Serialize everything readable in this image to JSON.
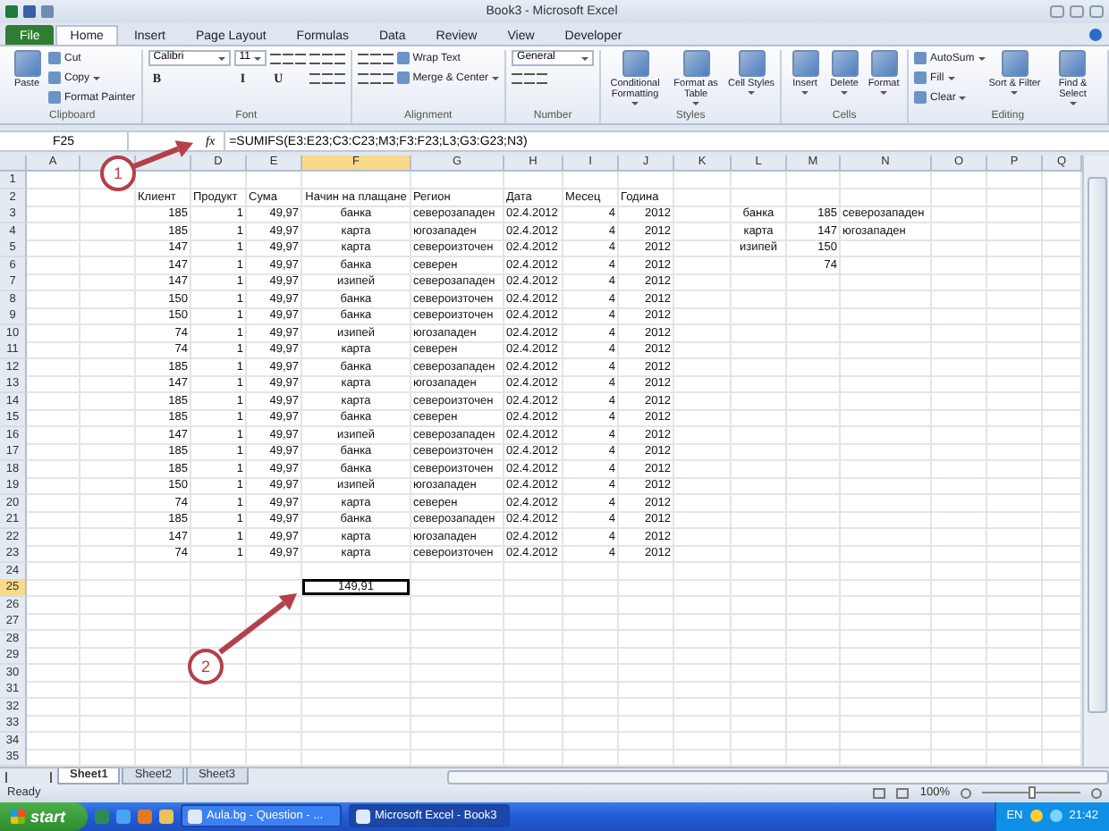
{
  "window": {
    "title": "Book3 - Microsoft Excel"
  },
  "ribbon_tabs": [
    {
      "label": "File",
      "kind": "file",
      "selected": false
    },
    {
      "label": "Home",
      "kind": "tab",
      "selected": true
    },
    {
      "label": "Insert",
      "kind": "tab",
      "selected": false
    },
    {
      "label": "Page Layout",
      "kind": "tab",
      "selected": false
    },
    {
      "label": "Formulas",
      "kind": "tab",
      "selected": false
    },
    {
      "label": "Data",
      "kind": "tab",
      "selected": false
    },
    {
      "label": "Review",
      "kind": "tab",
      "selected": false
    },
    {
      "label": "View",
      "kind": "tab",
      "selected": false
    },
    {
      "label": "Developer",
      "kind": "tab",
      "selected": false
    }
  ],
  "ribbon_groups": [
    {
      "label": "Clipboard",
      "columns": [
        [
          {
            "kind": "large",
            "label": "Paste"
          }
        ],
        [
          {
            "kind": "small",
            "label": "Cut"
          },
          {
            "kind": "small",
            "label": "Copy",
            "menu": true
          },
          {
            "kind": "small",
            "label": "Format Painter"
          }
        ]
      ]
    },
    {
      "label": "Font",
      "columns": [
        [
          {
            "kind": "field",
            "value": "Calibri",
            "wide": true
          },
          {
            "kind": "glyph",
            "label": "B"
          }
        ],
        [
          {
            "kind": "field",
            "value": "11",
            "wide": false
          },
          {
            "kind": "glyph",
            "label": "I"
          }
        ],
        [
          {
            "kind": "tools"
          },
          {
            "kind": "glyph",
            "label": "U"
          }
        ],
        [
          {
            "kind": "tools"
          },
          {
            "kind": "tools"
          }
        ]
      ]
    },
    {
      "label": "Alignment",
      "columns": [
        [
          {
            "kind": "tools"
          },
          {
            "kind": "tools"
          }
        ],
        [
          {
            "kind": "small",
            "label": "Wrap Text"
          },
          {
            "kind": "small",
            "label": "Merge & Center",
            "menu": true
          }
        ]
      ]
    },
    {
      "label": "Number",
      "columns": [
        [
          {
            "kind": "field",
            "value": "General",
            "wide": true
          },
          {
            "kind": "tools"
          }
        ]
      ]
    },
    {
      "label": "Styles",
      "columns": [
        [
          {
            "kind": "large",
            "label": "Conditional Formatting",
            "menu": true
          }
        ],
        [
          {
            "kind": "large",
            "label": "Format as Table",
            "menu": true
          }
        ],
        [
          {
            "kind": "large",
            "label": "Cell Styles",
            "menu": true
          }
        ]
      ]
    },
    {
      "label": "Cells",
      "columns": [
        [
          {
            "kind": "large",
            "label": "Insert",
            "menu": true
          }
        ],
        [
          {
            "kind": "large",
            "label": "Delete",
            "menu": true
          }
        ],
        [
          {
            "kind": "large",
            "label": "Format",
            "menu": true
          }
        ]
      ]
    },
    {
      "label": "Editing",
      "columns": [
        [
          {
            "kind": "small",
            "label": "AutoSum",
            "menu": true
          },
          {
            "kind": "small",
            "label": "Fill",
            "menu": true
          },
          {
            "kind": "small",
            "label": "Clear",
            "menu": true
          }
        ],
        [
          {
            "kind": "large",
            "label": "Sort & Filter",
            "menu": true
          }
        ],
        [
          {
            "kind": "large",
            "label": "Find & Select",
            "menu": true
          }
        ]
      ]
    }
  ],
  "formula_bar": {
    "name_box": "F25",
    "function_label": "fx",
    "formula": "=SUMIFS(E3:E23;C3:C23;M3;F3:F23;L3;G3:G23;N3)"
  },
  "columns": [
    {
      "label": "A",
      "selected": false
    },
    {
      "selected": false
    },
    {
      "selected": false
    },
    {
      "label": "D",
      "selected": false
    },
    {
      "label": "E",
      "selected": false
    },
    {
      "label": "F",
      "selected": true
    },
    {
      "label": "G",
      "selected": false
    },
    {
      "label": "H",
      "selected": false
    },
    {
      "label": "I",
      "selected": false
    },
    {
      "label": "J",
      "selected": false
    },
    {
      "label": "K",
      "selected": false
    },
    {
      "label": "L",
      "selected": false
    },
    {
      "label": "M",
      "selected": false
    },
    {
      "label": "N",
      "selected": false
    },
    {
      "label": "O",
      "selected": false
    },
    {
      "label": "P",
      "selected": false
    },
    {
      "label": "Q",
      "selected": false
    }
  ],
  "rows": [
    {
      "number": "1",
      "selected": false
    },
    {
      "number": "2",
      "selected": false,
      "cells": [
        null,
        null,
        "Клиент",
        "Продукт",
        "Сума",
        "Начин на плащане",
        "Регион",
        "Дата",
        "Месец",
        "Година",
        null,
        null,
        null,
        null,
        null,
        null,
        null
      ]
    },
    {
      "number": "3",
      "selected": false,
      "cells": [
        null,
        null,
        "185",
        "1",
        "49,97",
        "банка",
        "северозападен",
        "02.4.2012",
        "4",
        "2012",
        null,
        "банка",
        "185",
        "северозападен",
        null,
        null,
        null
      ]
    },
    {
      "number": "4",
      "selected": false,
      "cells": [
        null,
        null,
        "185",
        "1",
        "49,97",
        "карта",
        "югозападен",
        "02.4.2012",
        "4",
        "2012",
        null,
        "карта",
        "147",
        "югозападен",
        null,
        null,
        null
      ]
    },
    {
      "number": "5",
      "selected": false,
      "cells": [
        null,
        null,
        "147",
        "1",
        "49,97",
        "карта",
        "североизточен",
        "02.4.2012",
        "4",
        "2012",
        null,
        "изипей",
        "150",
        null,
        null,
        null,
        null
      ]
    },
    {
      "number": "6",
      "selected": false,
      "cells": [
        null,
        null,
        "147",
        "1",
        "49,97",
        "банка",
        "северен",
        "02.4.2012",
        "4",
        "2012",
        null,
        null,
        "74",
        null,
        null,
        null,
        null
      ]
    },
    {
      "number": "7",
      "selected": false,
      "cells": [
        null,
        null,
        "147",
        "1",
        "49,97",
        "изипей",
        "северозападен",
        "02.4.2012",
        "4",
        "2012",
        null,
        null,
        null,
        null,
        null,
        null,
        null
      ]
    },
    {
      "number": "8",
      "selected": false,
      "cells": [
        null,
        null,
        "150",
        "1",
        "49,97",
        "банка",
        "североизточен",
        "02.4.2012",
        "4",
        "2012",
        null,
        null,
        null,
        null,
        null,
        null,
        null
      ]
    },
    {
      "number": "9",
      "selected": false,
      "cells": [
        null,
        null,
        "150",
        "1",
        "49,97",
        "банка",
        "североизточен",
        "02.4.2012",
        "4",
        "2012",
        null,
        null,
        null,
        null,
        null,
        null,
        null
      ]
    },
    {
      "number": "10",
      "selected": false,
      "cells": [
        null,
        null,
        "74",
        "1",
        "49,97",
        "изипей",
        "югозападен",
        "02.4.2012",
        "4",
        "2012",
        null,
        null,
        null,
        null,
        null,
        null,
        null
      ]
    },
    {
      "number": "11",
      "selected": false,
      "cells": [
        null,
        null,
        "74",
        "1",
        "49,97",
        "карта",
        "северен",
        "02.4.2012",
        "4",
        "2012",
        null,
        null,
        null,
        null,
        null,
        null,
        null
      ]
    },
    {
      "number": "12",
      "selected": false,
      "cells": [
        null,
        null,
        "185",
        "1",
        "49,97",
        "банка",
        "северозападен",
        "02.4.2012",
        "4",
        "2012",
        null,
        null,
        null,
        null,
        null,
        null,
        null
      ]
    },
    {
      "number": "13",
      "selected": false,
      "cells": [
        null,
        null,
        "147",
        "1",
        "49,97",
        "карта",
        "югозападен",
        "02.4.2012",
        "4",
        "2012",
        null,
        null,
        null,
        null,
        null,
        null,
        null
      ]
    },
    {
      "number": "14",
      "selected": false,
      "cells": [
        null,
        null,
        "185",
        "1",
        "49,97",
        "карта",
        "североизточен",
        "02.4.2012",
        "4",
        "2012",
        null,
        null,
        null,
        null,
        null,
        null,
        null
      ]
    },
    {
      "number": "15",
      "selected": false,
      "cells": [
        null,
        null,
        "185",
        "1",
        "49,97",
        "банка",
        "северен",
        "02.4.2012",
        "4",
        "2012",
        null,
        null,
        null,
        null,
        null,
        null,
        null
      ]
    },
    {
      "number": "16",
      "selected": false,
      "cells": [
        null,
        null,
        "147",
        "1",
        "49,97",
        "изипей",
        "северозападен",
        "02.4.2012",
        "4",
        "2012",
        null,
        null,
        null,
        null,
        null,
        null,
        null
      ]
    },
    {
      "number": "17",
      "selected": false,
      "cells": [
        null,
        null,
        "185",
        "1",
        "49,97",
        "банка",
        "североизточен",
        "02.4.2012",
        "4",
        "2012",
        null,
        null,
        null,
        null,
        null,
        null,
        null
      ]
    },
    {
      "number": "18",
      "selected": false,
      "cells": [
        null,
        null,
        "185",
        "1",
        "49,97",
        "банка",
        "североизточен",
        "02.4.2012",
        "4",
        "2012",
        null,
        null,
        null,
        null,
        null,
        null,
        null
      ]
    },
    {
      "number": "19",
      "selected": false,
      "cells": [
        null,
        null,
        "150",
        "1",
        "49,97",
        "изипей",
        "югозападен",
        "02.4.2012",
        "4",
        "2012",
        null,
        null,
        null,
        null,
        null,
        null,
        null
      ]
    },
    {
      "number": "20",
      "selected": false,
      "cells": [
        null,
        null,
        "74",
        "1",
        "49,97",
        "карта",
        "северен",
        "02.4.2012",
        "4",
        "2012",
        null,
        null,
        null,
        null,
        null,
        null,
        null
      ]
    },
    {
      "number": "21",
      "selected": false,
      "cells": [
        null,
        null,
        "185",
        "1",
        "49,97",
        "банка",
        "северозападен",
        "02.4.2012",
        "4",
        "2012",
        null,
        null,
        null,
        null,
        null,
        null,
        null
      ]
    },
    {
      "number": "22",
      "selected": false,
      "cells": [
        null,
        null,
        "147",
        "1",
        "49,97",
        "карта",
        "югозападен",
        "02.4.2012",
        "4",
        "2012",
        null,
        null,
        null,
        null,
        null,
        null,
        null
      ]
    },
    {
      "number": "23",
      "selected": false,
      "cells": [
        null,
        null,
        "74",
        "1",
        "49,97",
        "карта",
        "североизточен",
        "02.4.2012",
        "4",
        "2012",
        null,
        null,
        null,
        null,
        null,
        null,
        null
      ]
    },
    {
      "number": "24",
      "selected": false
    },
    {
      "number": "25",
      "selected": true,
      "cells": [
        null,
        null,
        null,
        null,
        null,
        "149,91",
        null,
        null,
        null,
        null,
        null,
        null,
        null,
        null,
        null,
        null,
        null
      ]
    },
    {
      "number": "26",
      "selected": false
    },
    {
      "number": "27",
      "selected": false
    },
    {
      "number": "28",
      "selected": false
    },
    {
      "number": "29",
      "selected": false
    },
    {
      "number": "30",
      "selected": false
    },
    {
      "number": "31",
      "selected": false
    },
    {
      "number": "32",
      "selected": false
    },
    {
      "number": "33",
      "selected": false
    },
    {
      "number": "34",
      "selected": false
    },
    {
      "number": "35",
      "selected": false
    }
  ],
  "callouts": [
    {
      "label": "1"
    },
    {
      "label": "2"
    }
  ],
  "sheet_tabs": [
    {
      "label": "Sheet1",
      "selected": true
    },
    {
      "label": "Sheet2",
      "selected": false
    },
    {
      "label": "Sheet3",
      "selected": false
    }
  ],
  "status_bar": {
    "status": "Ready",
    "zoom": "100%",
    "level": 0.5
  },
  "taskbar": {
    "start": "start",
    "tasks": [
      {
        "label": "Aula.bg - Question - ...",
        "selected": false
      },
      {
        "label": "Microsoft Excel - Book3",
        "selected": true
      }
    ],
    "language": "EN",
    "clock": "21:42"
  }
}
